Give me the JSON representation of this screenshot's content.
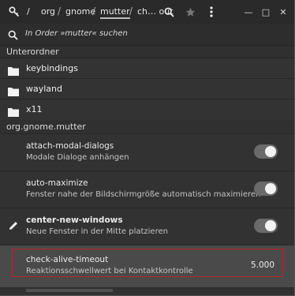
{
  "header": {
    "breadcrumbs": [
      {
        "label": "/",
        "active": false
      },
      {
        "label": "org",
        "active": false
      },
      {
        "label": "gnome",
        "active": false
      },
      {
        "label": "mutter",
        "active": true
      },
      {
        "label": "ch… out",
        "active": false
      }
    ],
    "separators": [
      "/",
      "/",
      "/",
      "/"
    ],
    "icons": {
      "app": "key-search-icon",
      "search": "search-icon",
      "bookmark": "star-icon",
      "menu": "more-vertical-icon"
    },
    "window_controls": {
      "minimize": "—",
      "maximize": "□",
      "close": "✕"
    }
  },
  "search": {
    "placeholder": "In Order »mutter« suchen"
  },
  "sections": {
    "subfolders_title": "Unterordner",
    "keys_title": "org.gnome.mutter"
  },
  "folders": [
    {
      "label": "keybindings"
    },
    {
      "label": "wayland"
    },
    {
      "label": "x11"
    }
  ],
  "keys": [
    {
      "name": "attach-modal-dialogs",
      "description": "Modale Dialoge anhängen",
      "kind": "toggle",
      "value": true,
      "edited": false
    },
    {
      "name": "auto-maximize",
      "description": "Fenster nahe der Bildschirmgröße automatisch maximieren",
      "kind": "toggle",
      "value": true,
      "edited": false
    },
    {
      "name": "center-new-windows",
      "description": "Neue Fenster in der Mitte platzieren",
      "kind": "toggle",
      "value": true,
      "edited": true
    },
    {
      "name": "check-alive-timeout",
      "description": "Reaktionsschwellwert bei Kontaktkontrolle",
      "kind": "value",
      "value": "5.000",
      "edited": false,
      "selected": true
    }
  ],
  "colors": {
    "background": "#303030",
    "selected_row": "#4a4a4a",
    "highlight_frame": "#b62727",
    "toggle_track": "#6a6a6a",
    "toggle_knob": "#f2f2f2"
  }
}
